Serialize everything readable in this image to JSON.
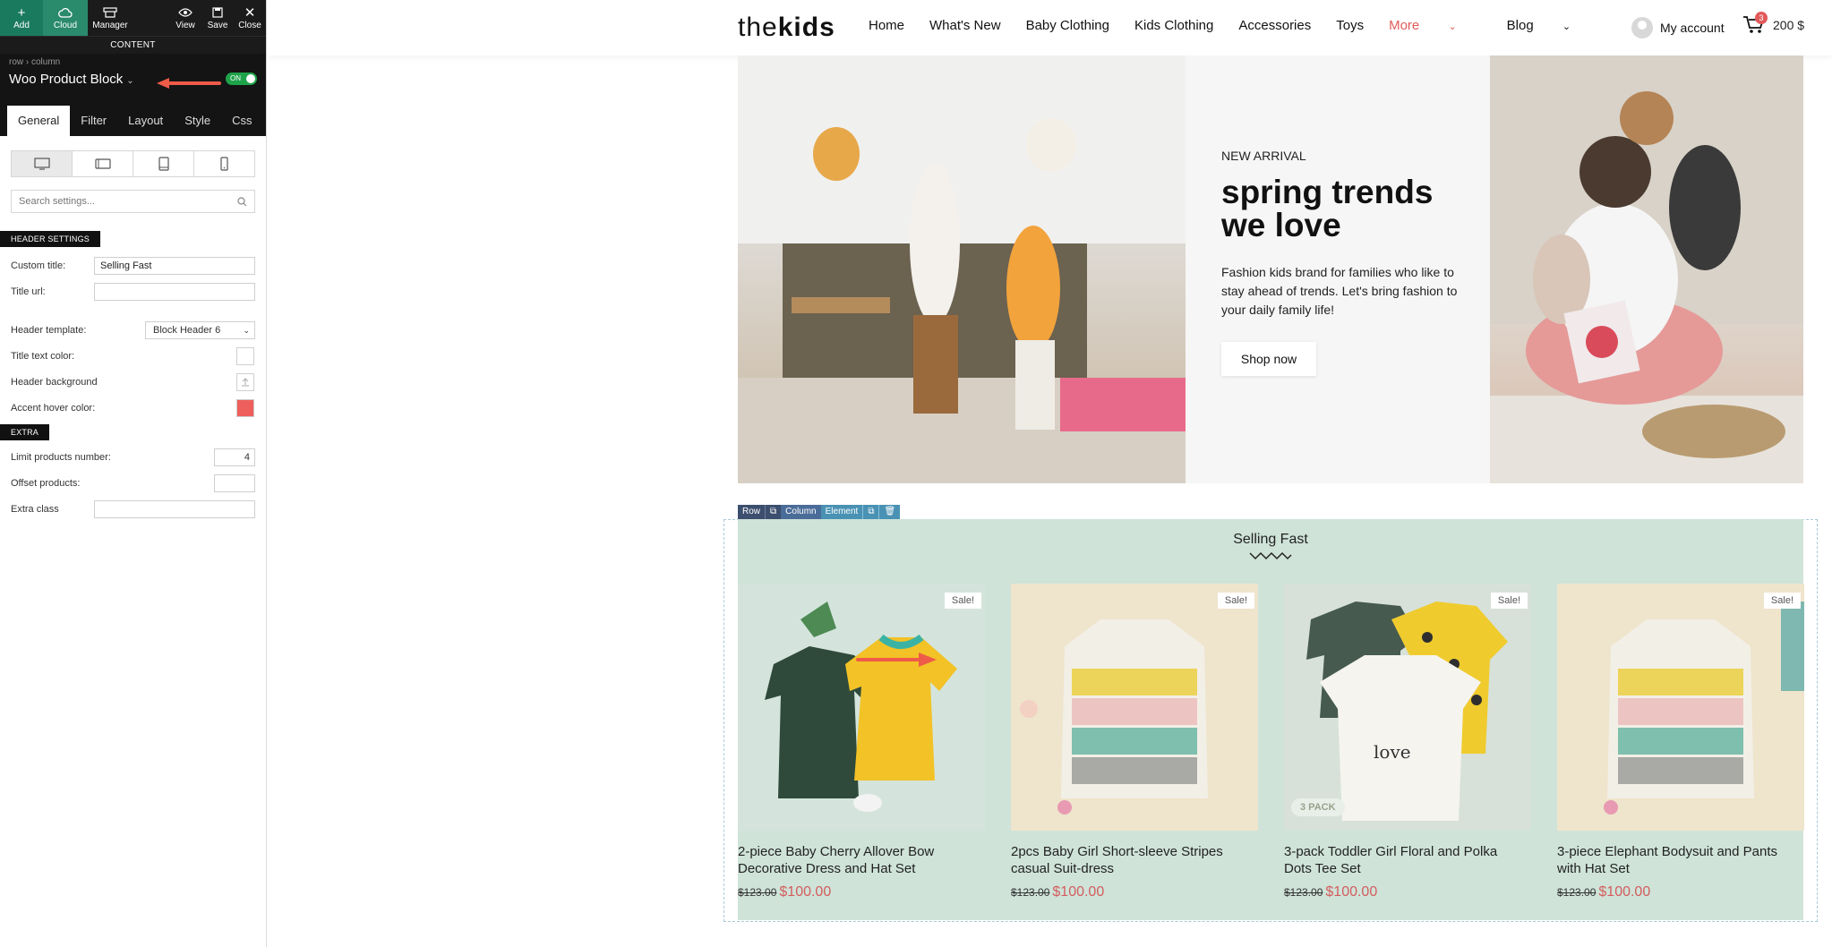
{
  "toolbar": {
    "add": "Add",
    "cloud": "Cloud",
    "manager": "Manager",
    "view": "View",
    "save": "Save",
    "close": "Close"
  },
  "panel": {
    "strip": "CONTENT",
    "breadcrumb": "row  ›  column",
    "element_title": "Woo Product Block",
    "toggle": "ON",
    "tabs": [
      "General",
      "Filter",
      "Layout",
      "Style",
      "Css"
    ],
    "search_placeholder": "Search settings...",
    "header_settings": "HEADER SETTINGS",
    "custom_title_label": "Custom title:",
    "custom_title_value": "Selling Fast",
    "title_url_label": "Title url:",
    "header_template_label": "Header template:",
    "header_template_value": "Block Header 6",
    "title_color_label": "Title text color:",
    "header_bg_label": "Header background",
    "accent_label": "Accent hover color:",
    "accent_color": "#ee5f5b",
    "extra": "EXTRA",
    "limit_label": "Limit products number:",
    "limit_value": "4",
    "offset_label": "Offset products:",
    "extra_class_label": "Extra class"
  },
  "site": {
    "logo_light": "the",
    "logo_bold": "kids",
    "nav": [
      "Home",
      "What's New",
      "Baby Clothing",
      "Kids Clothing",
      "Accessories",
      "Toys",
      "More",
      "Blog"
    ],
    "account": "My account",
    "cart_count": "3",
    "cart_total": "200 $",
    "hero": {
      "kicker": "NEW ARRIVAL",
      "title": "spring trends we love",
      "desc": "Fashion kids brand for families who like to stay ahead of trends. Let's bring fashion to your daily family life!",
      "button": "Shop now"
    },
    "editbar": {
      "row": "Row",
      "column": "Column",
      "element": "Element"
    },
    "section_title": "Selling Fast",
    "products": [
      {
        "name": "2-piece Baby Cherry Allover Bow Decorative Dress and Hat Set",
        "old": "$123.00",
        "price": "$100.00",
        "badge": "Sale!"
      },
      {
        "name": "2pcs Baby Girl Short-sleeve Stripes casual Suit-dress",
        "old": "$123.00",
        "price": "$100.00",
        "badge": "Sale!"
      },
      {
        "name": "3-pack Toddler Girl Floral and Polka Dots Tee Set",
        "old": "$123.00",
        "price": "$100.00",
        "badge": "Sale!",
        "tag": "3 PACK"
      },
      {
        "name": "3-piece Elephant Bodysuit and Pants with Hat Set",
        "old": "$123.00",
        "price": "$100.00",
        "badge": "Sale!"
      }
    ]
  }
}
